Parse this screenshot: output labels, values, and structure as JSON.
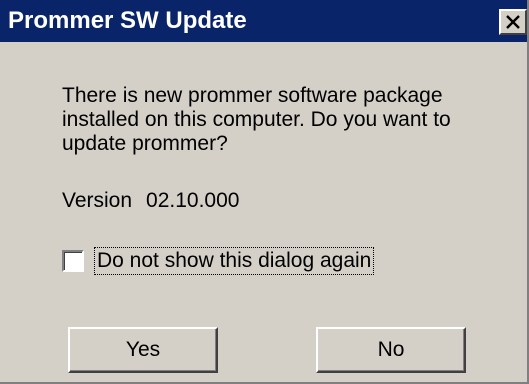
{
  "window": {
    "title": "Prommer SW Update",
    "close_icon": "close-icon",
    "titlebar_color": "#0a246a",
    "face_color": "#d4d0c8"
  },
  "message": {
    "lines": [
      "There is new prommer software package",
      "installed on this computer. Do you want to",
      "update prommer?"
    ]
  },
  "version": {
    "label": "Version",
    "value": "02.10.000"
  },
  "checkbox": {
    "label": "Do not show this dialog again",
    "checked": false
  },
  "buttons": {
    "yes_label": "Yes",
    "no_label": "No"
  }
}
